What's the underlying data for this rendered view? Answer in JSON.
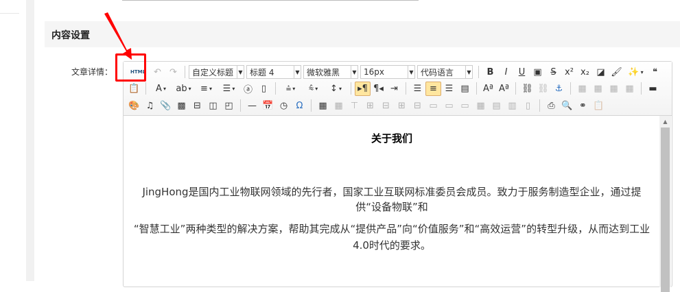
{
  "section": {
    "title": "内容设置"
  },
  "field": {
    "label": "文章详情："
  },
  "toolbar": {
    "html_label": "HTML",
    "selects": {
      "custom_heading": "自定义标题",
      "paragraph": "标题 4",
      "font_family": "微软雅黑",
      "font_size": "16px",
      "code_language": "代码语言"
    },
    "row1_left": [
      "undo-icon",
      "redo-icon"
    ],
    "row1_right": [
      "bold-icon",
      "italic-icon",
      "underline-icon",
      "font-border-icon",
      "strikethrough-icon",
      "superscript-icon",
      "subscript-icon",
      "eraser-icon",
      "format-brush-icon",
      "magic-wand-icon",
      "blockquote-icon"
    ],
    "row2": [
      "paste-plain-icon",
      "sep",
      "font-color-icon",
      "background-color-icon",
      "ordered-list-icon",
      "unordered-list-icon",
      "sep-none",
      "select-all-icon",
      "clear-doc-icon",
      "sep",
      "row-spacing-top-icon",
      "row-spacing-bottom-icon",
      "line-height-icon",
      "sep",
      "direction-ltr-icon",
      "direction-rtl-icon",
      "indent-icon",
      "sep",
      "justify-left-icon",
      "justify-center-icon",
      "justify-right-icon",
      "justify-full-icon",
      "sep",
      "touppercase-icon",
      "tolowercase-icon",
      "sep",
      "link-icon",
      "unlink-icon",
      "anchor-icon",
      "sep",
      "image-left-icon",
      "image-right-icon",
      "image-none-icon",
      "image-center-icon",
      "sep",
      "insert-image-icon"
    ],
    "row3": [
      "scrawl-icon",
      "music-icon",
      "attachment-icon",
      "map-icon",
      "page-break-icon",
      "template-icon",
      "web-app-icon",
      "sep",
      "horizontal-rule-icon",
      "date-icon",
      "time-icon",
      "special-chars-icon",
      "sep",
      "insert-table-icon",
      "delete-table-icon",
      "insert-paragraph-before-table-icon",
      "insert-row-icon",
      "delete-row-icon",
      "insert-col-icon",
      "delete-col-icon",
      "merge-cells-icon",
      "merge-right-icon",
      "merge-down-icon",
      "split-to-cells-icon",
      "split-to-rows-icon",
      "split-to-cols-icon",
      "charts-icon",
      "sep",
      "print-icon",
      "preview-icon",
      "search-replace-icon",
      "paste-icon"
    ],
    "active": [
      "direction-ltr-icon",
      "justify-center-icon"
    ],
    "disabled": [
      "undo-icon",
      "redo-icon",
      "unlink-icon",
      "image-left-icon",
      "image-right-icon",
      "image-none-icon",
      "image-center-icon",
      "delete-table-icon",
      "insert-paragraph-before-table-icon",
      "insert-row-icon",
      "delete-row-icon",
      "insert-col-icon",
      "delete-col-icon",
      "merge-cells-icon",
      "merge-right-icon",
      "merge-down-icon",
      "split-to-cells-icon",
      "split-to-rows-icon",
      "split-to-cols-icon",
      "charts-icon",
      "paste-icon"
    ],
    "dropdowns": [
      "magic-wand-icon",
      "font-color-icon",
      "background-color-icon",
      "ordered-list-icon",
      "unordered-list-icon",
      "row-spacing-top-icon",
      "row-spacing-bottom-icon",
      "line-height-icon"
    ]
  },
  "content": {
    "title": "关于我们",
    "paragraph1": "JingHong是国内工业物联网领域的先行者，国家工业互联网标准委员会成员。致力于服务制造型企业，通过提供“设备物联”和",
    "paragraph2": "“智慧工业”两种类型的解决方案，帮助其完成从“提供产品”向“价值服务”和“高效运营”的转型升级，从而达到工业4.0时代的要求。"
  },
  "colors": {
    "highlight": "#ff0000",
    "active_button": "#ffe69f",
    "section_bg": "#f5f5f5"
  }
}
